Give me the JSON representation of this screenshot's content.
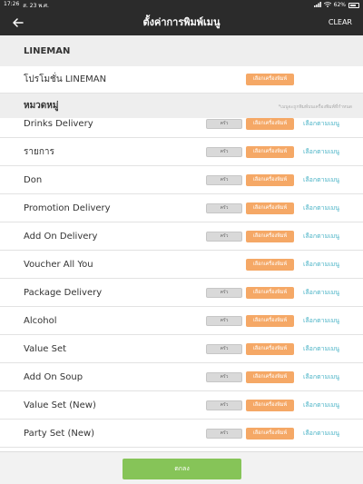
{
  "status": {
    "time": "17:26",
    "date": "ส. 23 พ.ศ.",
    "signal_icon": "signal-icon",
    "wifi_icon": "wifi-icon",
    "battery_text": "62%"
  },
  "header": {
    "title": "ตั้งค่าการพิมพ์เมนู",
    "clear_label": "CLEAR",
    "back_icon": "arrow-left-icon"
  },
  "lineman": {
    "section_title": "LINEMAN",
    "promo_label": "โปรโมชั่น LINEMAN",
    "promo_button": "เลือกเครื่องพิมพ์"
  },
  "category": {
    "section_title": "หมวดหมู่",
    "note": "*เมนูจะถูกพิมพ์บนเครื่องพิมพ์ที่กำหนด"
  },
  "rows": [
    {
      "label": "Drinks Delivery",
      "gray": "ครัว",
      "orange": "เลือกเครื่องพิมพ์",
      "link": "เลือกตามเมนู"
    },
    {
      "label": "รายการ",
      "gray": "ครัว",
      "orange": "เลือกเครื่องพิมพ์",
      "link": "เลือกตามเมนู"
    },
    {
      "label": "Don",
      "gray": "ครัว",
      "orange": "เลือกเครื่องพิมพ์",
      "link": "เลือกตามเมนู"
    },
    {
      "label": "Promotion Delivery",
      "gray": "ครัว",
      "orange": "เลือกเครื่องพิมพ์",
      "link": "เลือกตามเมนู"
    },
    {
      "label": "Add On Delivery",
      "gray": "ครัว",
      "orange": "เลือกเครื่องพิมพ์",
      "link": "เลือกตามเมนู"
    },
    {
      "label": "Voucher All You",
      "gray": "",
      "orange": "เลือกเครื่องพิมพ์",
      "link": "เลือกตามเมนู"
    },
    {
      "label": "Package Delivery",
      "gray": "ครัว",
      "orange": "เลือกเครื่องพิมพ์",
      "link": "เลือกตามเมนู"
    },
    {
      "label": "Alcohol",
      "gray": "ครัว",
      "orange": "เลือกเครื่องพิมพ์",
      "link": "เลือกตามเมนู"
    },
    {
      "label": "Value Set",
      "gray": "ครัว",
      "orange": "เลือกเครื่องพิมพ์",
      "link": "เลือกตามเมนู"
    },
    {
      "label": "Add On Soup",
      "gray": "ครัว",
      "orange": "เลือกเครื่องพิมพ์",
      "link": "เลือกตามเมนู"
    },
    {
      "label": "Value Set (New)",
      "gray": "ครัว",
      "orange": "เลือกเครื่องพิมพ์",
      "link": "เลือกตามเมนู"
    },
    {
      "label": "Party Set (New)",
      "gray": "ครัว",
      "orange": "เลือกเครื่องพิมพ์",
      "link": "เลือกตามเมนู"
    }
  ],
  "footer": {
    "ok_label": "ตกลง"
  },
  "colors": {
    "header_bg": "#2b2b2b",
    "orange": "#f5a866",
    "link": "#4ab3c6",
    "ok_green": "#86c458"
  }
}
